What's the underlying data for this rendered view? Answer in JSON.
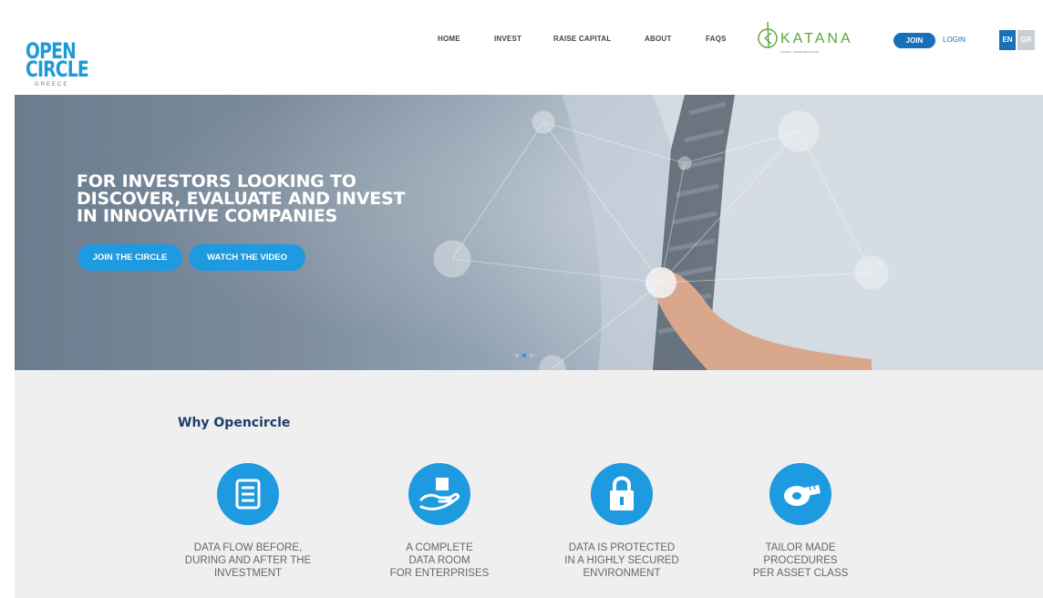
{
  "header": {
    "logo": {
      "line1": "PEN",
      "line2": "IRCLE",
      "line3": "GREECE"
    },
    "nav": [
      {
        "label": "HOME"
      },
      {
        "label": "INVEST"
      },
      {
        "label": "RAISE CAPITAL"
      },
      {
        "label": "ABOUT"
      },
      {
        "label": "FAQS"
      }
    ],
    "partner": {
      "name": "KATANA",
      "tagline": "KATANA · INVESTMENT FUND"
    },
    "join_label": "JOIN",
    "login_label": "LOGIN",
    "lang_en": "EN",
    "lang_gr": "GR"
  },
  "hero": {
    "heading_lines": [
      "FOR INVESTORS LOOKING TO",
      "DISCOVER, EVALUATE AND INVEST",
      "IN INNOVATIVE COMPANIES"
    ],
    "btn_join_circle": "JOIN THE CIRCLE",
    "btn_watch_video": "WATCH THE VIDEO",
    "slides": 3,
    "active_slide": 2
  },
  "why": {
    "title": "Why Opencircle",
    "features": [
      {
        "icon": "server-icon",
        "lines": [
          "DATA FLOW BEFORE,",
          "DURING AND AFTER THE",
          "INVESTMENT"
        ]
      },
      {
        "icon": "hand-box-icon",
        "lines": [
          "A COMPLETE",
          "DATA ROOM",
          "FOR ENTERPRISES"
        ]
      },
      {
        "icon": "lock-icon",
        "lines": [
          "DATA IS PROTECTED",
          "IN A HIGHLY SECURED",
          "ENVIRONMENT"
        ]
      },
      {
        "icon": "tape-measure-icon",
        "lines": [
          "TAILOR MADE",
          "PROCEDURES",
          "PER ASSET CLASS"
        ]
      }
    ]
  },
  "colors": {
    "brand_blue": "#1e9ae0",
    "dark_blue": "#1770b8",
    "title_blue": "#1d3d6a",
    "katana_green": "#5aa33a"
  }
}
